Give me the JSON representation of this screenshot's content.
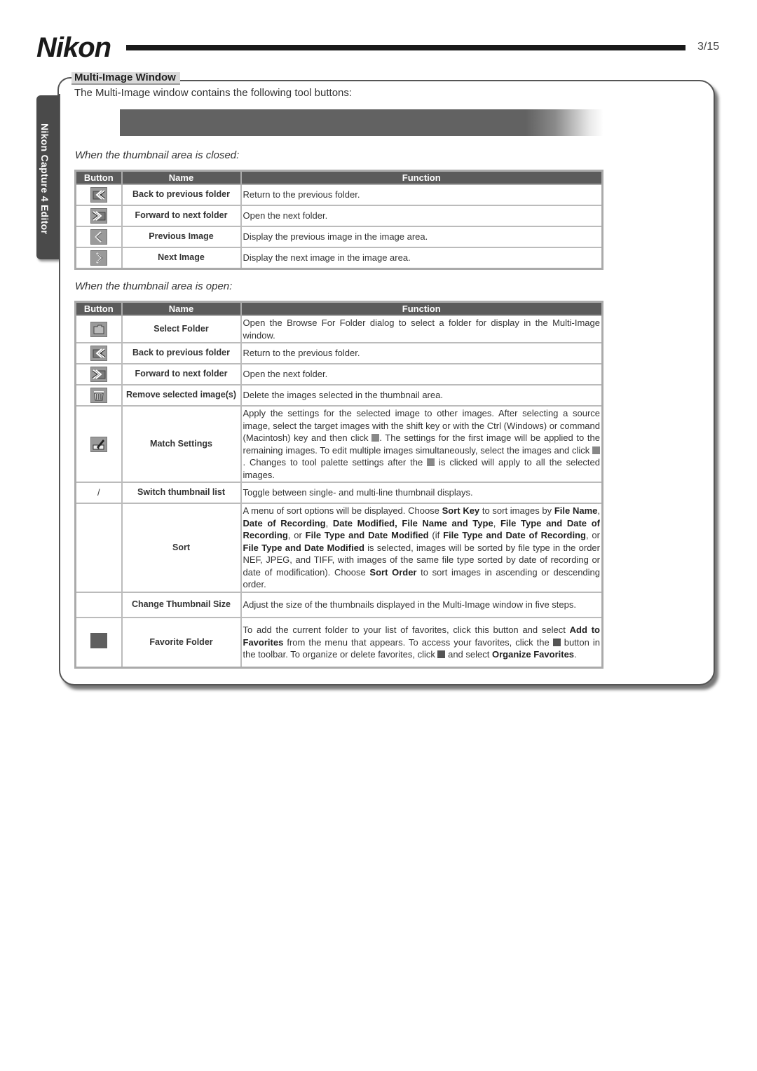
{
  "header": {
    "brand": "Nikon",
    "page_number": "3/15"
  },
  "side_tab": {
    "label": "Nikon Capture 4 Editor"
  },
  "section": {
    "title": "Multi-Image Window",
    "intro": "The Multi-Image window contains the following tool buttons:"
  },
  "closed_table": {
    "subheading": "When the thumbnail area is closed:",
    "columns": [
      "Button",
      "Name",
      "Function"
    ],
    "rows": [
      {
        "icon": "back-folder-icon",
        "name": "Back to previous folder",
        "function": "Return to the previous folder."
      },
      {
        "icon": "forward-folder-icon",
        "name": "Forward to next folder",
        "function": "Open the next folder."
      },
      {
        "icon": "previous-image-icon",
        "name": "Previous Image",
        "function": "Display the previous image in the image area."
      },
      {
        "icon": "next-image-icon",
        "name": "Next Image",
        "function": "Display the next image in the image area."
      }
    ]
  },
  "open_table": {
    "subheading": "When the thumbnail area is open:",
    "columns": [
      "Button",
      "Name",
      "Function"
    ],
    "rows": [
      {
        "icon": "select-folder-icon",
        "name": "Select Folder",
        "function": "Open the Browse For Folder dialog to select a folder for display in the Multi-Image window."
      },
      {
        "icon": "back-folder-icon",
        "name": "Back to previous folder",
        "function": "Return to the previous folder."
      },
      {
        "icon": "forward-folder-icon",
        "name": "Forward to next folder",
        "function": "Open the next folder."
      },
      {
        "icon": "trash-icon",
        "name": "Remove selected image(s)",
        "function": "Delete the images selected in the thumbnail area."
      },
      {
        "icon": "match-settings-icon",
        "name": "Match Settings",
        "function_parts": [
          "Apply the settings for the selected image to other images.  After selecting a source image, select the target images with the shift key or with the Ctrl (Windows) or command (Macintosh) key and then click ",
          ".  The settings for the first image will be applied to the remaining images.  To edit multiple images simultaneously, select the images and click ",
          ".  Changes to tool palette settings after the ",
          " is clicked will apply to all the selected images."
        ]
      },
      {
        "icon_text": "/",
        "name": "Switch thumbnail list",
        "function": "Toggle between single- and multi-line thumbnail displays."
      },
      {
        "icon": "",
        "name": "Sort",
        "function_parts": [
          {
            "t": "A menu of sort options will be displayed.  Choose ",
            "b": false
          },
          {
            "t": "Sort Key",
            "b": true
          },
          {
            "t": " to sort images by ",
            "b": false
          },
          {
            "t": "File Name",
            "b": true
          },
          {
            "t": ", ",
            "b": false
          },
          {
            "t": "Date of Recording",
            "b": true
          },
          {
            "t": ", ",
            "b": false
          },
          {
            "t": "Date Modified, File Name and Type",
            "b": true
          },
          {
            "t": ", ",
            "b": false
          },
          {
            "t": "File Type and Date of Recording",
            "b": true
          },
          {
            "t": ", or ",
            "b": false
          },
          {
            "t": "File Type and Date Modified",
            "b": true
          },
          {
            "t": " (if ",
            "b": false
          },
          {
            "t": "File Type and Date of Recording",
            "b": true
          },
          {
            "t": ", or ",
            "b": false
          },
          {
            "t": "File Type and Date Modified",
            "b": true
          },
          {
            "t": " is selected, images will be sorted by file type in the order NEF, JPEG, and TIFF, with images of the same file type sorted by date of recording or date of modification).  Choose ",
            "b": false
          },
          {
            "t": "Sort Order",
            "b": true
          },
          {
            "t": " to sort images in ascending or descending order.",
            "b": false
          }
        ]
      },
      {
        "icon": "",
        "name": "Change Thumbnail Size",
        "function": "Adjust the size of the thumbnails displayed in the Multi-Image window in five steps."
      },
      {
        "icon": "favorite-folder-icon",
        "name": "Favorite Folder",
        "function_parts": [
          {
            "t": "To add the current folder to your list of favorites, click this button and select ",
            "b": false
          },
          {
            "t": "Add to Favorites",
            "b": true
          },
          {
            "t": " from the menu that appears.  To access your favorites, click the ",
            "b": false
          },
          {
            "icon": "favorite-folder-icon"
          },
          {
            "t": " button in the toolbar.  To organize or delete favorites, click ",
            "b": false
          },
          {
            "icon": "favorite-folder-icon"
          },
          {
            "t": " and select ",
            "b": false
          },
          {
            "t": "Organize Favorites",
            "b": true
          },
          {
            "t": ".",
            "b": false
          }
        ]
      }
    ]
  }
}
